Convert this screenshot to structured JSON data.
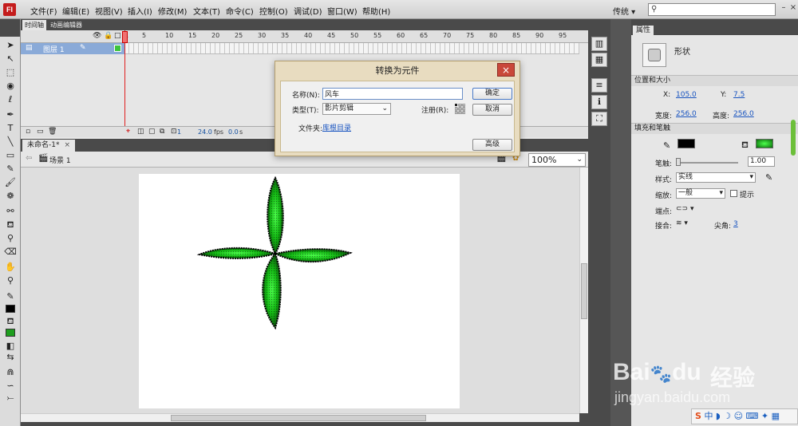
{
  "menu": {
    "logo": "Fl",
    "items": [
      "文件(F)",
      "编辑(E)",
      "视图(V)",
      "插入(I)",
      "修改(M)",
      "文本(T)",
      "命令(C)",
      "控制(O)",
      "调试(D)",
      "窗口(W)",
      "帮助(H)"
    ],
    "workspace": "传统 ▾",
    "search_icon": "⚲",
    "win_min": "–",
    "win_max": "□",
    "win_close": "×"
  },
  "timeline": {
    "tabs": [
      "时间轴",
      "动画编辑器"
    ],
    "ruler": [
      "1",
      "5",
      "10",
      "15",
      "20",
      "25",
      "30",
      "35",
      "40",
      "45",
      "50",
      "55",
      "60",
      "65",
      "70",
      "75",
      "80",
      "85",
      "90",
      "95"
    ],
    "layer_name": "图层 1",
    "frame_number": "1",
    "fps": "24.0",
    "fps_unit": "fps",
    "time": "0.0",
    "time_unit": "s"
  },
  "document": {
    "tab": "未命名-1*",
    "close": "×",
    "scene": "场景 1",
    "zoom": "100%"
  },
  "dialog": {
    "title": "转换为元件",
    "close": "×",
    "name_label": "名称(N):",
    "name_value": "风车",
    "type_label": "类型(T):",
    "type_value": "影片剪辑",
    "reg_label": "注册(R):",
    "folder_label": "文件夹:",
    "folder_value": "库根目录",
    "ok": "确定",
    "cancel": "取消",
    "advanced": "高级"
  },
  "properties": {
    "tab": "属性",
    "object": "形状",
    "section_pos": "位置和大小",
    "x_label": "X:",
    "x": "105.0",
    "y_label": "Y:",
    "y": "7.5",
    "w_label": "宽度:",
    "w": "256.0",
    "h_label": "高度:",
    "h": "256.0",
    "section_fill": "填充和笔触",
    "stroke_label": "笔触:",
    "stroke": "1.00",
    "style_label": "样式:",
    "style": "实线",
    "scale_label": "缩放:",
    "scale": "一般",
    "hint": "提示",
    "cap_label": "端点:",
    "join_label": "接合:",
    "miter_label": "尖角:",
    "miter": "3"
  },
  "watermark": {
    "brand": "Bai",
    "brand2": "du",
    "cn": "经验",
    "url": "jingyan.baidu.com"
  },
  "ime": {
    "label": "中 ◗ ☽ ☺ ⌨ ✦ ▦"
  },
  "colors": {
    "fill": "#1e9e1e",
    "stroke": "#000000",
    "selection": "#8aaad8"
  }
}
